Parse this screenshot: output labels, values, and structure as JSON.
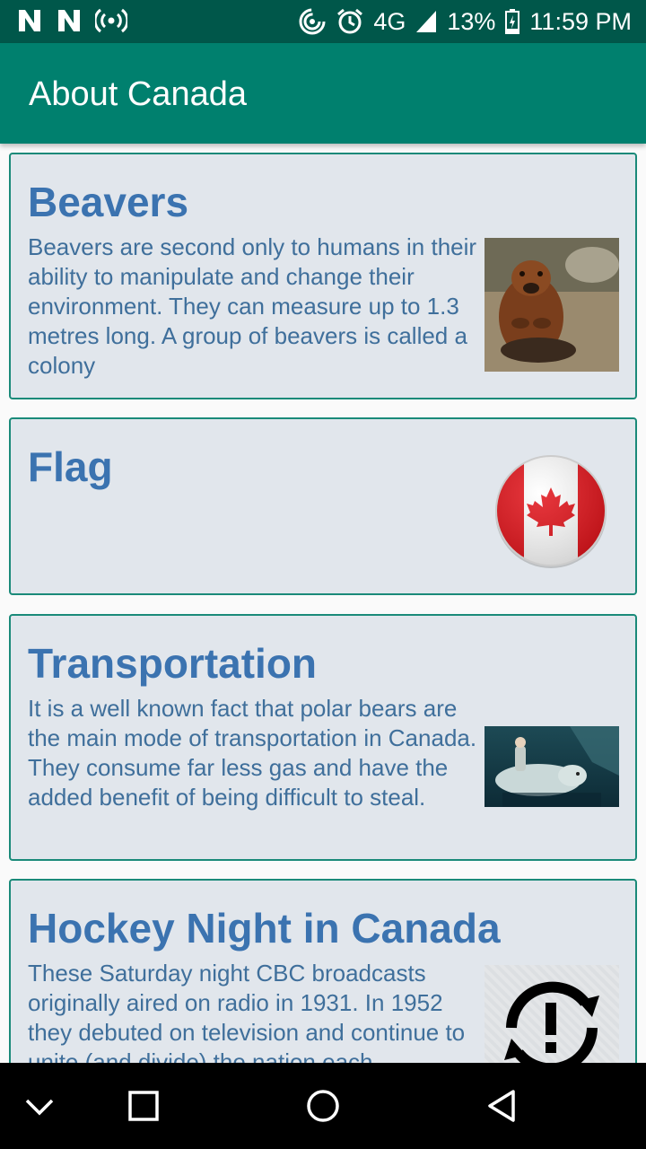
{
  "status_bar": {
    "icons_left": [
      "n-notification-icon",
      "n-notification-icon",
      "hotspot-icon"
    ],
    "network": "4G",
    "battery": "13%",
    "time": "11:59 PM"
  },
  "app_bar": {
    "title": "About Canada"
  },
  "cards": [
    {
      "title": "Beavers",
      "body": "Beavers are second only to humans in their ability to manipulate and change their environment. They can measure up to 1.3 metres long. A group of beavers is called a colony",
      "image": "beaver-image"
    },
    {
      "title": "Flag",
      "body": "",
      "image": "canada-flag-image"
    },
    {
      "title": "Transportation",
      "body": "It is a well known fact that polar bears are the main mode of transportation in Canada. They consume far less gas and have the added benefit of being difficult to steal.",
      "image": "polar-bear-image"
    },
    {
      "title": "Hockey Night in Canada",
      "body": "These Saturday night CBC broadcasts originally aired on radio in 1931. In 1952 they debuted on television and continue to unite (and divide) the nation each",
      "image": "loading-error-icon"
    }
  ],
  "nav_bar": {
    "buttons": [
      "collapse-icon",
      "recents-icon",
      "home-icon",
      "back-icon"
    ]
  },
  "colors": {
    "status_bar": "#00574a",
    "app_bar": "#00806e",
    "card_bg": "#e1e6ec",
    "card_border": "#1a8a79",
    "title_text": "#3b73b0"
  }
}
